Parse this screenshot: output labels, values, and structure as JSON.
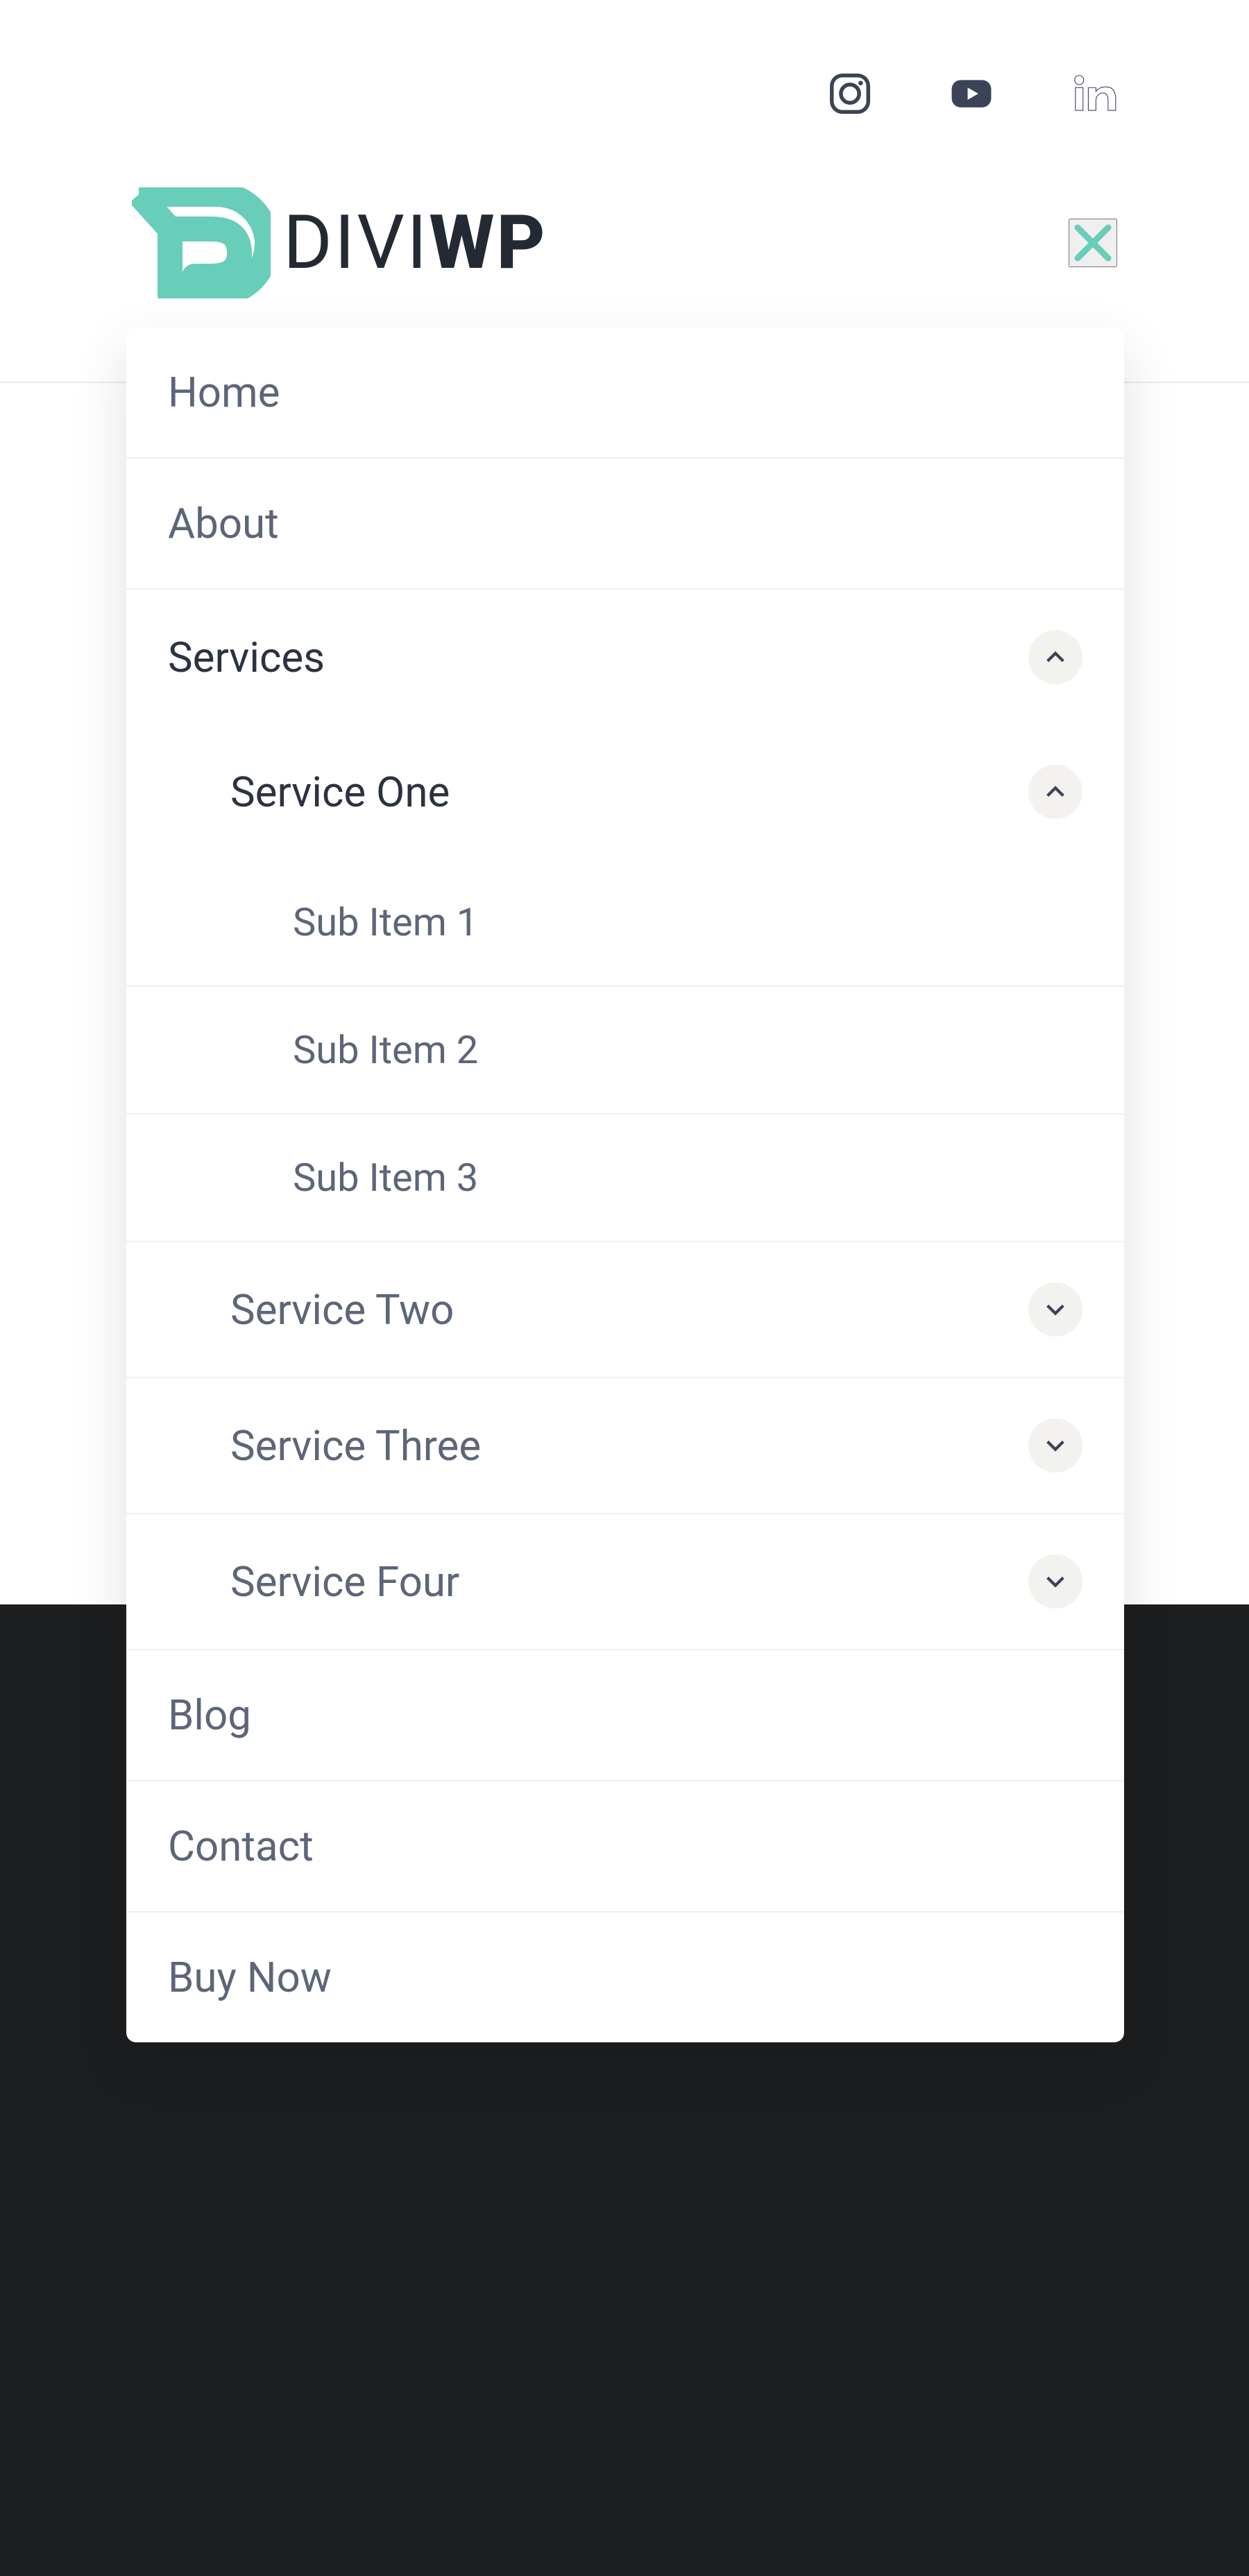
{
  "brand": {
    "name_light": "DIVI",
    "name_bold": "WP"
  },
  "social": {
    "instagram": "instagram-icon",
    "youtube": "youtube-icon",
    "linkedin": "linkedin-icon"
  },
  "close_label": "Close",
  "menu": {
    "home": "Home",
    "about": "About",
    "services": {
      "label": "Services",
      "expanded": true,
      "items": {
        "one": {
          "label": "Service One",
          "expanded": true,
          "sub": [
            "Sub Item 1",
            "Sub Item 2",
            "Sub Item 3"
          ]
        },
        "two": {
          "label": "Service Two",
          "expanded": false
        },
        "three": {
          "label": "Service Three",
          "expanded": false
        },
        "four": {
          "label": "Service Four",
          "expanded": false
        }
      }
    },
    "blog": "Blog",
    "contact": "Contact",
    "buy": "Buy Now"
  }
}
